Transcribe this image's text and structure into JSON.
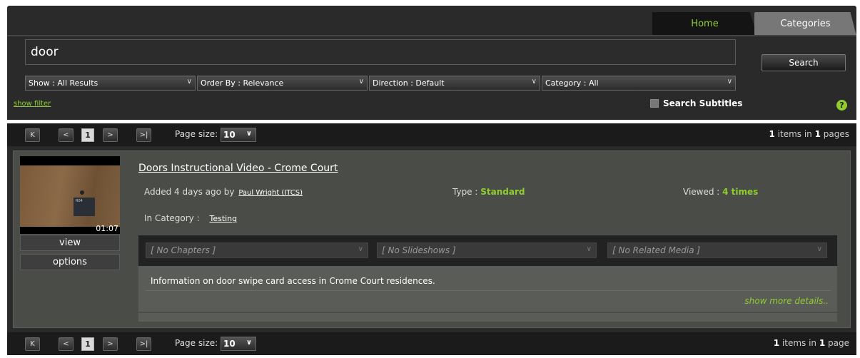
{
  "tabs": {
    "home": "Home",
    "categories": "Categories"
  },
  "search": {
    "value": "door",
    "button": "Search"
  },
  "filters": {
    "show": "Show : All Results",
    "order": "Order By : Relevance",
    "direction": "Direction : Default",
    "category": "Category : All"
  },
  "show_filter": "show filter",
  "search_subtitles": "Search Subtitles",
  "help": "?",
  "pager_top": {
    "first": "K",
    "prev": "<",
    "page": "1",
    "next": ">",
    "last": ">|",
    "size_label": "Page size:",
    "size_value": "10",
    "items": "1",
    "items_text": " items in ",
    "pages": "1",
    "pages_text": " pages"
  },
  "pager_bottom": {
    "first": "K",
    "prev": "<",
    "page": "1",
    "next": ">",
    "last": ">|",
    "size_label": "Page size:",
    "size_value": "10",
    "items": "1",
    "items_text": " items in ",
    "pages": "1",
    "pages_text": " page"
  },
  "result": {
    "title": "Doors Instructional Video - Crome Court",
    "duration": "01:07",
    "door_label": "R04",
    "added_prefix": "Added 4 days ago by",
    "author": "Paul Wright (ITCS)",
    "type_label": "Type : ",
    "type_value": "Standard",
    "viewed_label": "Viewed : ",
    "viewed_value": "4 times",
    "category_label": "In Category :",
    "category_value": "Testing",
    "view_button": "view",
    "options_button": "options",
    "chapters": "[ No Chapters ]",
    "slideshows": "[ No Slideshows ]",
    "related": "[ No Related Media ]",
    "description": "Information on door swipe card access in Crome Court residences.",
    "more": "show more details.."
  }
}
